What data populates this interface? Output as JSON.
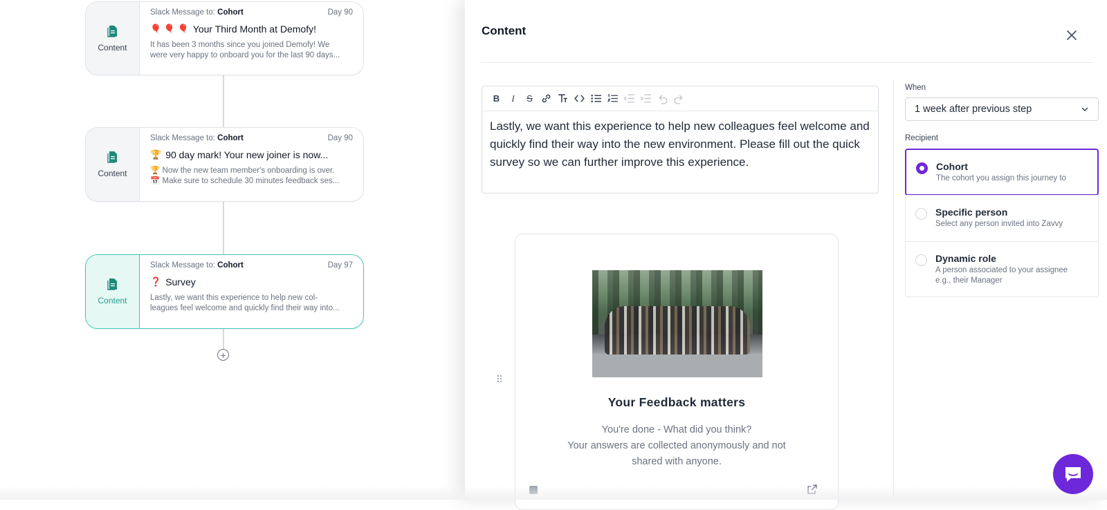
{
  "flow": {
    "cards": [
      {
        "type_label": "Content",
        "channel_prefix": "Slack Message to:",
        "recipient": "Cohort",
        "day": "Day 90",
        "emoji": "🎈 🎈 🎈",
        "title": "Your Third Month at Demofy!",
        "desc_lines": [
          "It has been 3 months since you joined Demofy! We",
          "were very happy to onboard you for the last 90 days..."
        ]
      },
      {
        "type_label": "Content",
        "channel_prefix": "Slack Message to:",
        "recipient": "Cohort",
        "day": "Day 90",
        "emoji": "🏆",
        "title": "90 day mark! Your new joiner is now...",
        "desc_lines": [
          "🏆 Now the new team member's onboarding is over.",
          "📅 Make sure to schedule 30 minutes feedback ses..."
        ]
      },
      {
        "type_label": "Content",
        "channel_prefix": "Slack Message to:",
        "recipient": "Cohort",
        "day": "Day 97",
        "emoji": "❓",
        "title": "Survey",
        "desc_lines": [
          "Lastly, we want this experience to help new col-",
          "leagues feel welcome and quickly find their way into..."
        ]
      }
    ],
    "add_step_symbol": "+"
  },
  "panel": {
    "title": "Content",
    "editor": {
      "text": "Lastly, we want this experience to help new colleagues feel welcome and quickly find their way into the new environment. Please fill out the quick survey so we can further improve this experience."
    },
    "survey_card": {
      "title": "Your Feedback matters",
      "subtitle_lines": [
        "You're done - What did you think?",
        "Your answers are collected anonymously and not",
        "shared with anyone."
      ]
    },
    "settings": {
      "when_label": "When",
      "when_value": "1 week after previous step",
      "recipient_label": "Recipient",
      "options": [
        {
          "title": "Cohort",
          "desc": "The cohort you assign this journey to",
          "selected": true
        },
        {
          "title": "Specific person",
          "desc": "Select any person invited into Zavvy",
          "selected": false
        },
        {
          "title": "Dynamic role",
          "desc": "A person associated to your assignee e.g., their Manager",
          "selected": false
        }
      ]
    }
  },
  "colors": {
    "accent_teal": "#3cc7b2",
    "accent_purple": "#6d28d9"
  }
}
